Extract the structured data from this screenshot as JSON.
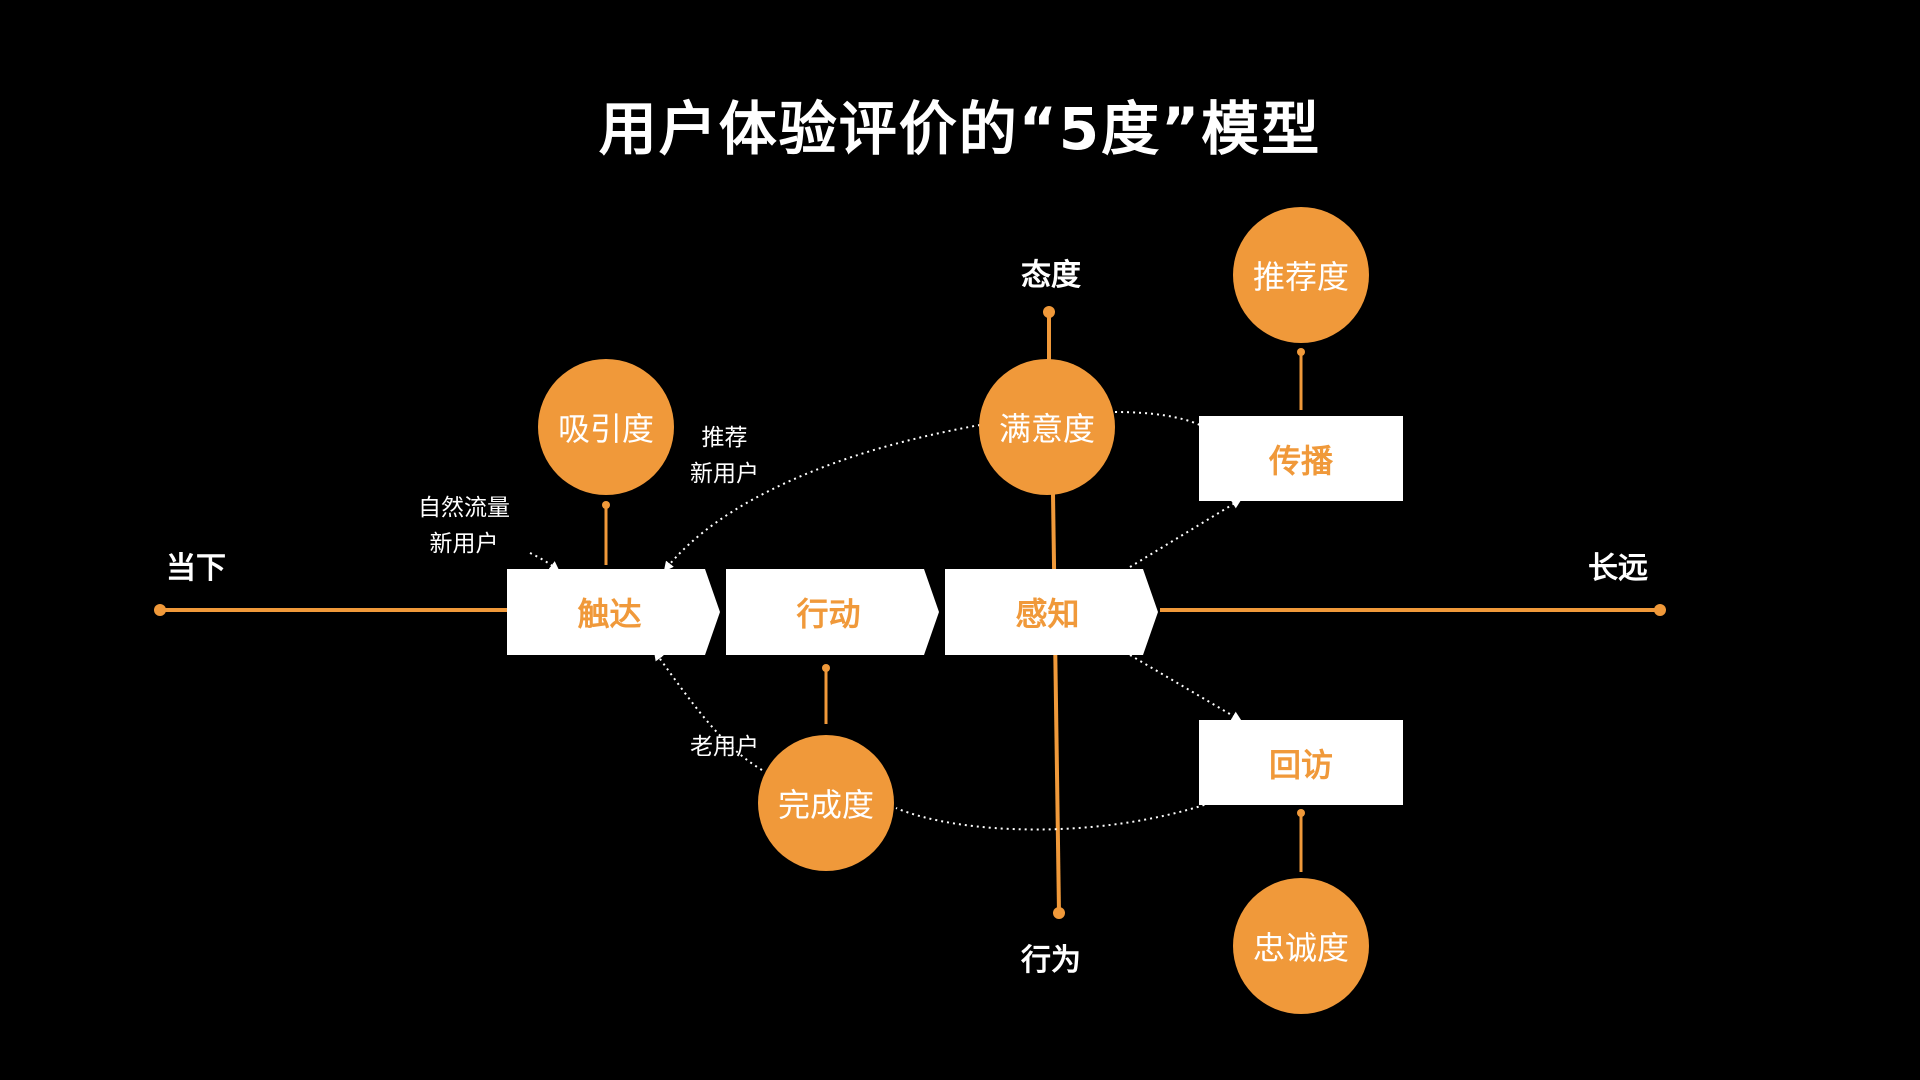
{
  "title": "用户体验评价的“5度”模型",
  "axis": {
    "left": "当下",
    "right": "长远",
    "top": "态度",
    "bottom": "行为"
  },
  "stages": [
    "触达",
    "行动",
    "感知"
  ],
  "degrees": {
    "attraction": "吸引度",
    "completion": "完成度",
    "satisfaction": "满意度",
    "recommendation": "推荐度",
    "loyalty": "忠诚度"
  },
  "outcomes": {
    "spread": "传播",
    "revisit": "回访"
  },
  "annotations": {
    "natural_line1": "自然流量",
    "natural_line2": "新用户",
    "recommend_line1": "推荐",
    "recommend_line2": "新用户",
    "old_user": "老用户"
  },
  "colors": {
    "accent": "#f0993a",
    "background": "#000000",
    "box": "#ffffff"
  }
}
